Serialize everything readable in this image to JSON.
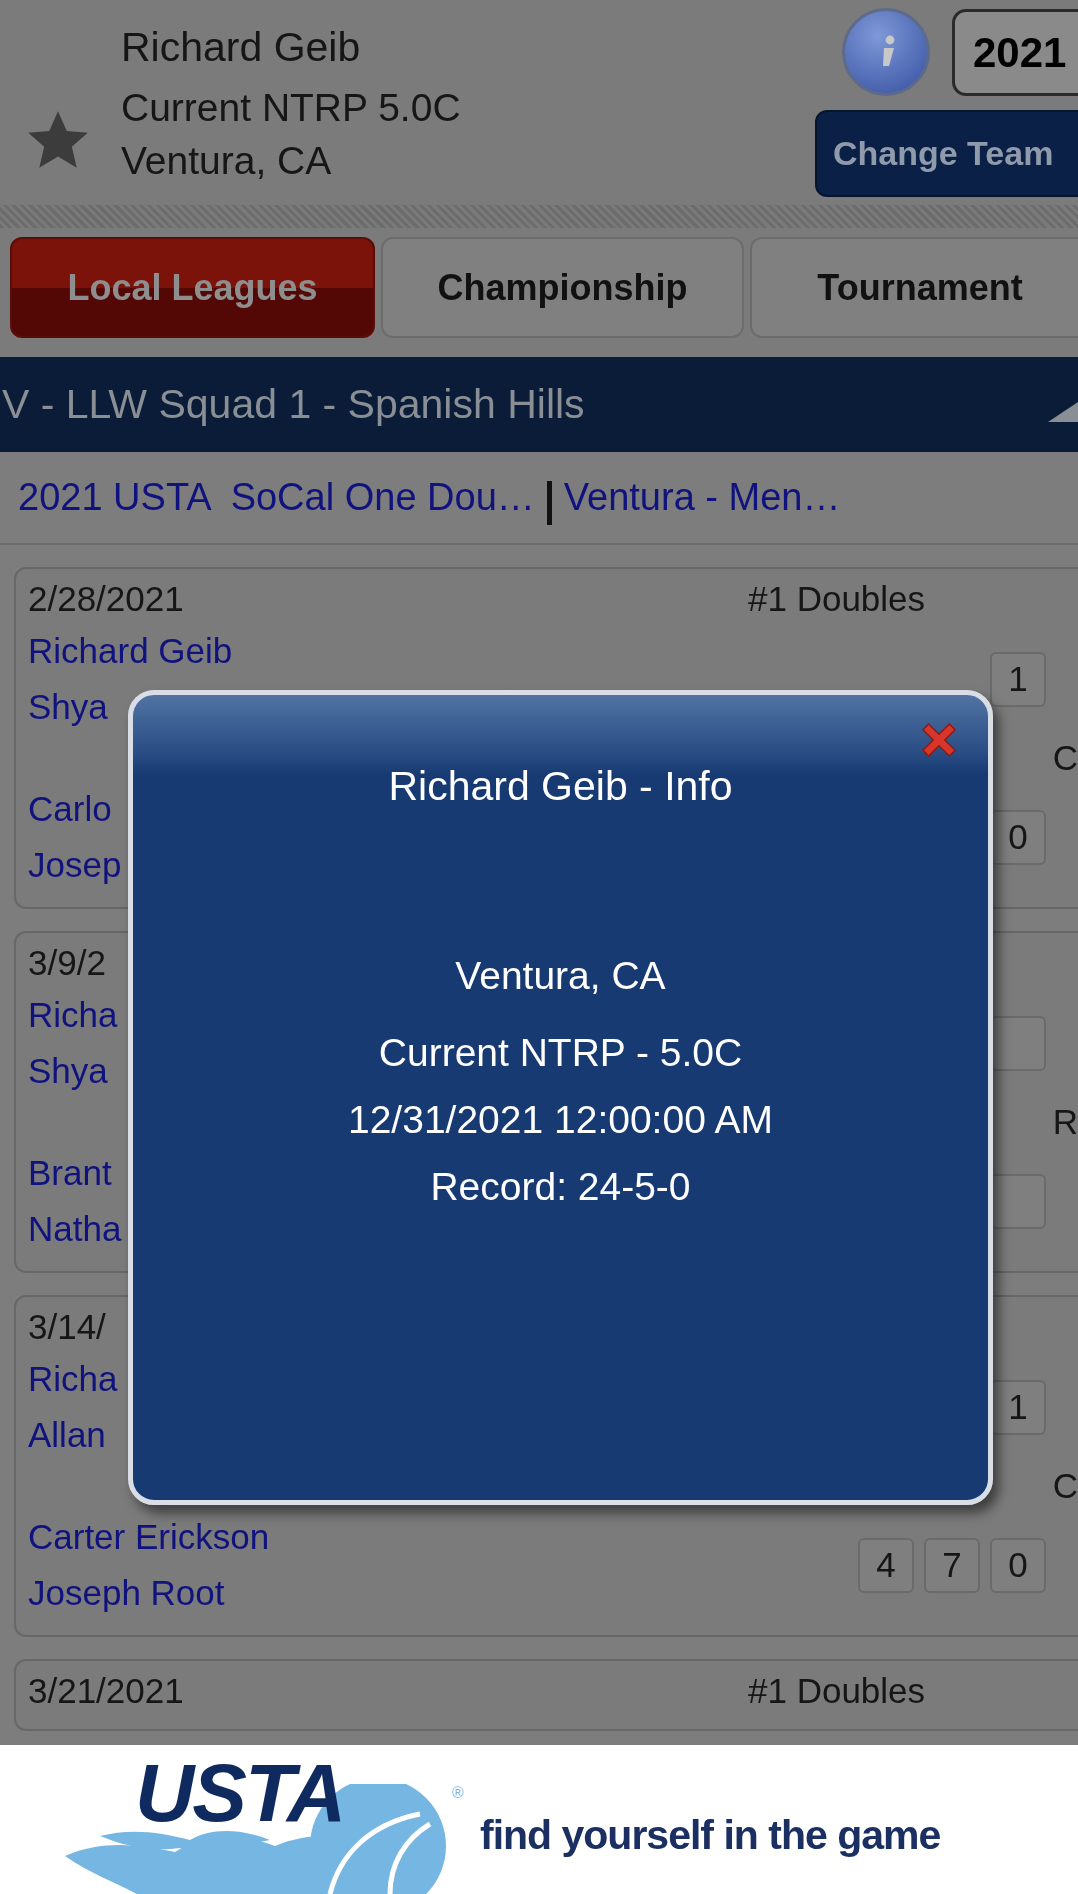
{
  "header": {
    "name": "Richard Geib",
    "rating": "Current NTRP 5.0C",
    "location": "Ventura, CA",
    "favorite": false,
    "year": "2021",
    "change_team": "Change Team"
  },
  "tabs": [
    {
      "label": "Local Leagues",
      "selected": true
    },
    {
      "label": "Championship",
      "selected": false
    },
    {
      "label": "Tournament",
      "selected": false
    }
  ],
  "team_bar": {
    "title": "V - LLW Squad 1 - Spanish Hills"
  },
  "links": [
    "2021 USTA  SoCal One Dou…",
    "Ventura - Men…"
  ],
  "matches": [
    {
      "date": "2/28/2021",
      "line": "#1 Doubles",
      "result": "C",
      "teams": [
        {
          "players": [
            "Richard Geib",
            "Shya"
          ],
          "scores": [
            "1"
          ]
        },
        {
          "players": [
            "Carlo",
            "Josep"
          ],
          "scores": [
            "0"
          ]
        }
      ]
    },
    {
      "date": "3/9/2",
      "result": "R",
      "teams": [
        {
          "players": [
            "Richa",
            "Shya"
          ],
          "scores": [
            {
              "kind": "blank"
            }
          ]
        },
        {
          "players": [
            "Brant",
            "Natha"
          ],
          "scores": [
            {
              "kind": "blank"
            }
          ]
        }
      ]
    },
    {
      "date": "3/14/",
      "result": "C",
      "teams": [
        {
          "players": [
            "Richa",
            "Allan"
          ],
          "scores": [
            "1"
          ]
        },
        {
          "players": [
            "Carter Erickson",
            "Joseph Root"
          ],
          "scores": [
            "4",
            "7",
            "0"
          ]
        }
      ]
    },
    {
      "date": "3/21/2021",
      "line": "#1 Doubles"
    }
  ],
  "modal": {
    "title": "Richard Geib - Info",
    "location": "Ventura, CA",
    "lines": [
      "Current NTRP - 5.0C",
      "12/31/2021 12:00:00 AM",
      "Record: 24-5-0"
    ]
  },
  "banner": {
    "logo": "USTA",
    "registered": "®",
    "tagline": "find yourself in the game"
  }
}
